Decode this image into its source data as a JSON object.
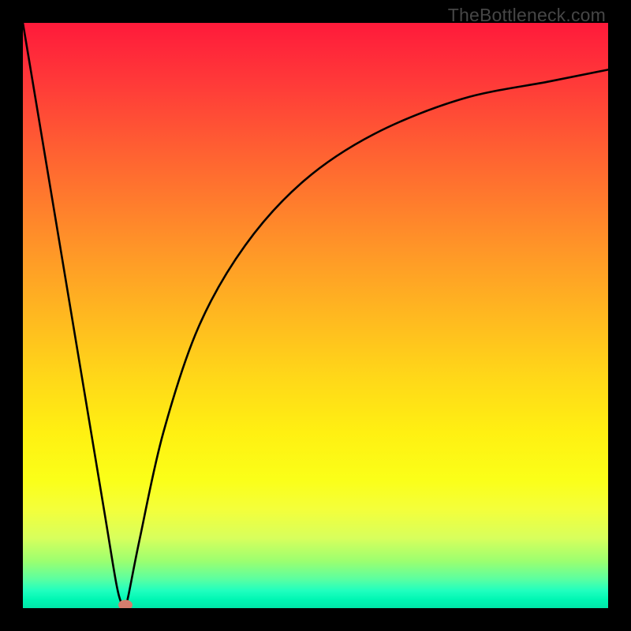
{
  "watermark": "TheBottleneck.com",
  "chart_data": {
    "type": "line",
    "title": "",
    "xlabel": "",
    "ylabel": "",
    "xlim": [
      0,
      100
    ],
    "ylim": [
      0,
      100
    ],
    "grid": false,
    "legend": false,
    "description": "Bottleneck curve: steep linear descent from top-left to a minimum near x≈17, then asymptotic rise toward top-right. Background is a vertical heat gradient (red=high bottleneck, green=low).",
    "series": [
      {
        "name": "bottleneck-curve",
        "x": [
          0,
          5,
          10,
          14,
          16,
          17,
          17.5,
          18,
          20,
          24,
          30,
          38,
          48,
          60,
          75,
          90,
          100
        ],
        "values": [
          100,
          70,
          40,
          16,
          4,
          0.5,
          0.5,
          2,
          12,
          30,
          48,
          62,
          73,
          81,
          87,
          90,
          92
        ]
      }
    ],
    "marker": {
      "x": 17.5,
      "y": 0.6,
      "color": "#d67d6e"
    },
    "background_gradient": {
      "direction": "vertical",
      "stops": [
        {
          "pos": 0,
          "color": "#ff1a3a"
        },
        {
          "pos": 0.5,
          "color": "#ffb820"
        },
        {
          "pos": 0.78,
          "color": "#fbff18"
        },
        {
          "pos": 1.0,
          "color": "#00e6a8"
        }
      ]
    }
  }
}
